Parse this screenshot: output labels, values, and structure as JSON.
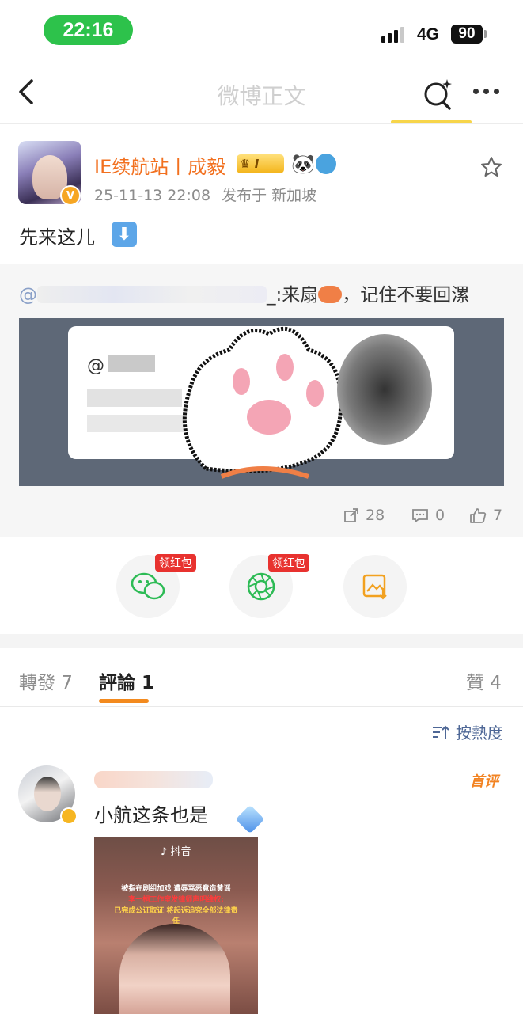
{
  "status_bar": {
    "time": "22:16",
    "network": "4G",
    "battery": "90"
  },
  "nav": {
    "title": "微博正文"
  },
  "post": {
    "username": "IE续航站丨成毅",
    "crown_badge_text": "I",
    "timestamp": "25-11-13 22:08",
    "location": "发布于 新加坡",
    "text": "先来这儿",
    "down_arrow": "⬇"
  },
  "repost": {
    "prefix": "@",
    "text_suffix": "_:来扇",
    "text_tail": "，记住不要回漯",
    "image_mention": "@"
  },
  "stats": {
    "share": "28",
    "comment": "0",
    "like": "7"
  },
  "share_row": {
    "wechat_badge": "领红包",
    "moments_badge": "领红包"
  },
  "tabs": [
    {
      "label": "轉發 7"
    },
    {
      "label": "評論 1"
    },
    {
      "label": "贊 4"
    }
  ],
  "sort": {
    "label": "按熱度"
  },
  "comment": {
    "first_comment_tag": "首评",
    "text": "小航这条也是",
    "image": {
      "app": "抖音",
      "headline_1": "被指在剧组加戏 遭辱骂恶意造黄谣",
      "headline_2": "李一桐工作室发律师声明维权:",
      "headline_3": "已完成公证取证 将起诉追究全部法律责任"
    }
  },
  "colors": {
    "accent": "#f38a1e",
    "username": "#f2701f",
    "status_pill": "#2dc24b",
    "badge_red": "#e8322f"
  }
}
